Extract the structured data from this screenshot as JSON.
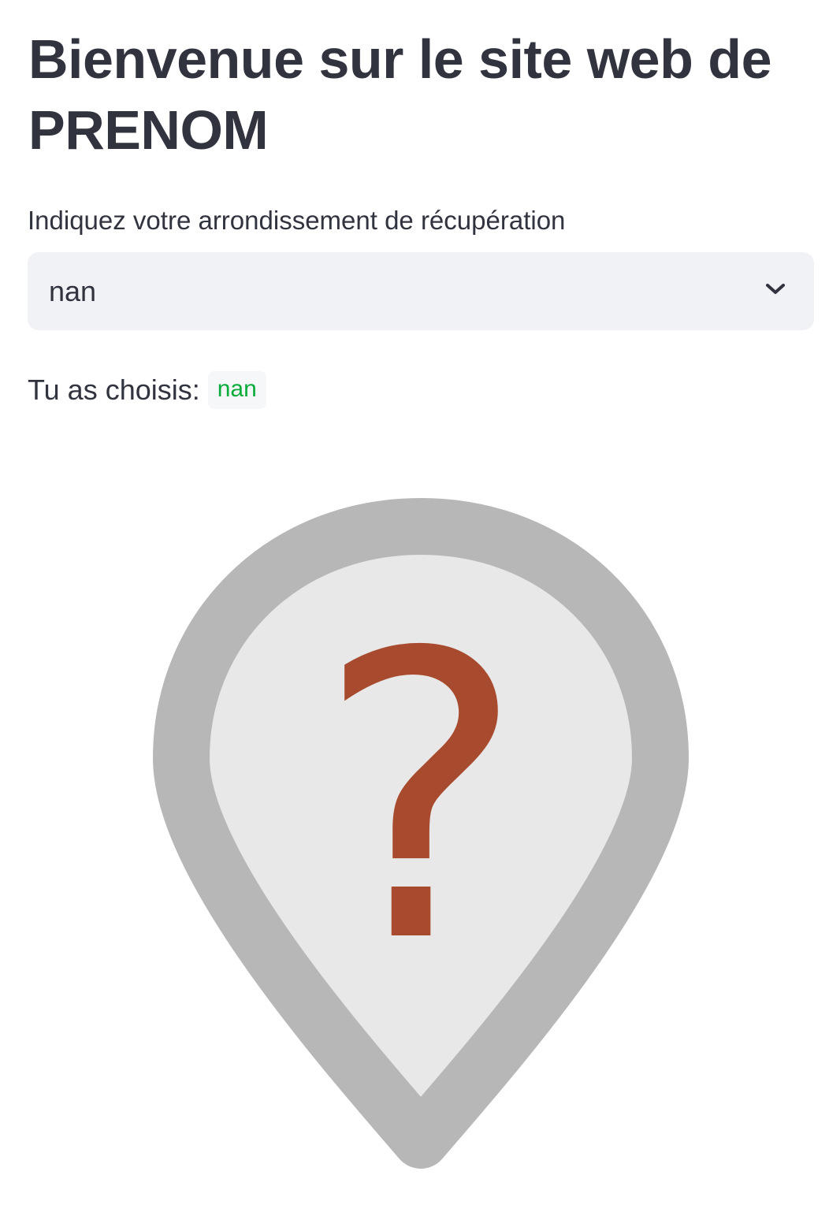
{
  "header": {
    "title": "Bienvenue sur le site web de PRENOM"
  },
  "form": {
    "label": "Indiquez votre arrondissement de récupération",
    "selected_value": "nan",
    "dropdown_icon": "chevron-down-icon"
  },
  "result": {
    "prefix": "Tu as choisis:",
    "value": "nan"
  },
  "illustration": {
    "icon": "unknown-location-marker-icon",
    "glyph": "?",
    "colors": {
      "pin_outline": "#b7b7b7",
      "pin_fill": "#e8e8e8",
      "question_mark": "#a84a2e"
    }
  },
  "theme": {
    "text": "#31333f",
    "select_bg": "#f0f2f6",
    "code_text": "#09ab3b",
    "code_bg": "#f6f7f9"
  }
}
